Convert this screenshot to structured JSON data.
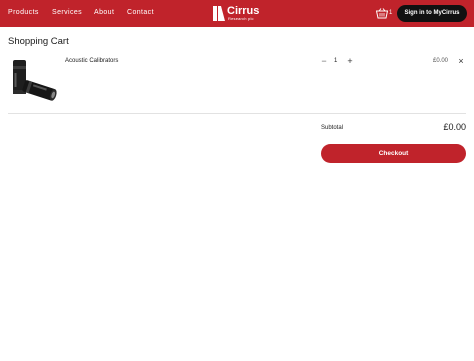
{
  "header": {
    "nav": [
      {
        "label": "Products"
      },
      {
        "label": "Services"
      },
      {
        "label": "About"
      },
      {
        "label": "Contact"
      }
    ],
    "logo": {
      "name": "Cirrus",
      "subtitle": "Research plc"
    },
    "cart_count": "1",
    "signin_label": "Sign in to MyCirrus",
    "icons": {
      "cart": "basket-icon",
      "logo_mark": "cirrus-logo-mark"
    },
    "colors": {
      "brand_red": "#c0232b",
      "signin_bg": "#111111"
    }
  },
  "cart": {
    "title": "Shopping Cart",
    "items": [
      {
        "name": "Acoustic Calibrators",
        "quantity": "1",
        "minus_symbol": "−",
        "plus_symbol": "+",
        "price": "£0.00",
        "remove_symbol": "×",
        "image": "acoustic-calibrator-product-image"
      }
    ],
    "subtotal_label": "Subtotal",
    "subtotal_value": "£0.00",
    "checkout_label": "Checkout"
  }
}
